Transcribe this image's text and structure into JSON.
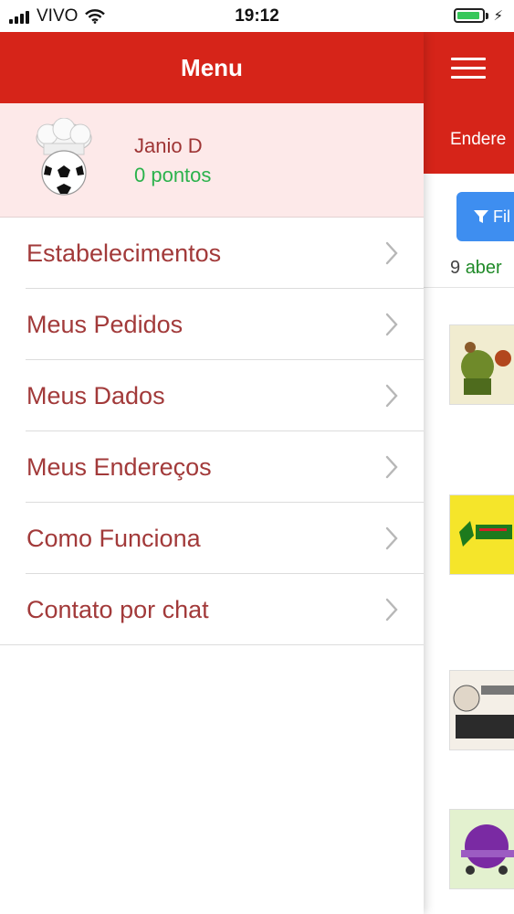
{
  "status_bar": {
    "carrier": "VIVO",
    "time": "19:12",
    "battery_level": 0.9,
    "icons": [
      "signal-icon",
      "wifi-icon",
      "battery-icon",
      "charging-icon"
    ]
  },
  "drawer": {
    "title": "Menu",
    "profile": {
      "name": "Janio D",
      "points": "0 pontos",
      "avatar_icon": "chef-hat-soccer-ball-avatar"
    },
    "items": [
      {
        "label": "Estabelecimentos"
      },
      {
        "label": "Meus Pedidos"
      },
      {
        "label": "Meus Dados"
      },
      {
        "label": "Meus Endereços"
      },
      {
        "label": "Como Funciona"
      },
      {
        "label": "Contato por chat"
      }
    ]
  },
  "background_page": {
    "address_label": "Endere",
    "filter_button": "Fil",
    "open_count": {
      "number": "9",
      "word": "aber"
    },
    "listing_thumbnails": [
      "establishment-logo-1",
      "establishment-logo-2",
      "establishment-logo-3",
      "establishment-logo-4"
    ]
  },
  "colors": {
    "brand_red": "#d62419",
    "profile_bg": "#fde9e9",
    "menu_text": "#a23a3a",
    "points_green": "#2bb24c",
    "filter_blue": "#3e8ef0"
  }
}
